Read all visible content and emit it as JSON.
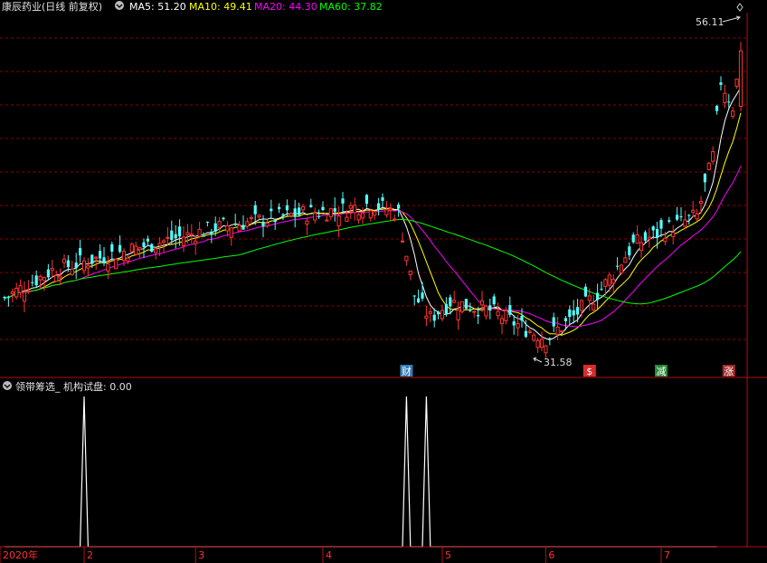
{
  "header": {
    "title": "康辰药业(日线 前复权)",
    "ma5_label": "MA5: 51.20",
    "ma10_label": "MA10: 49.41",
    "ma20_label": "MA20: 44.30",
    "ma60_label": "MA60: 37.82"
  },
  "sub_header": {
    "title": "领带筹选_ 机构试盘: 0.00"
  },
  "colors": {
    "up": "#ff3232",
    "down": "#54ffff",
    "ma5": "#ffffff",
    "ma10": "#ffff00",
    "ma20": "#ff00ff",
    "ma60": "#00ff00",
    "grid": "#8b0000",
    "axis": "#b01010"
  },
  "chart_data": [
    {
      "type": "candlestick",
      "name": "main",
      "ylim": [
        30,
        58
      ],
      "annotations": {
        "high_label": "56.11",
        "low_label": "31.58"
      },
      "event_markers": [
        {
          "index": 101,
          "text": "财",
          "color": "#3b8fd6"
        },
        {
          "index": 147,
          "text": "$",
          "color": "#ff3232"
        },
        {
          "index": 165,
          "text": "减",
          "color": "#2ea043"
        },
        {
          "index": 182,
          "text": "涨",
          "color": "#c03030"
        }
      ]
    },
    {
      "type": "line",
      "name": "indicator",
      "ylim": [
        0,
        1
      ],
      "series": [
        {
          "values": [
            0,
            0,
            0,
            0,
            0,
            0,
            0,
            0,
            0,
            0,
            0,
            0,
            0,
            0,
            0,
            0,
            0,
            0,
            0,
            0,
            1,
            0,
            0,
            0,
            0,
            0,
            0,
            0,
            0,
            0,
            0,
            0,
            0,
            0,
            0,
            0,
            0,
            0,
            0,
            0,
            0,
            0,
            0,
            0,
            0,
            0,
            0,
            0,
            0,
            0,
            0,
            0,
            0,
            0,
            0,
            0,
            0,
            0,
            0,
            0,
            0,
            0,
            0,
            0,
            0,
            0,
            0,
            0,
            0,
            0,
            0,
            0,
            0,
            0,
            0,
            0,
            0,
            0,
            0,
            0,
            0,
            0,
            0,
            0,
            0,
            0,
            0,
            0,
            0,
            0,
            0,
            0,
            0,
            0,
            0,
            0,
            0,
            0,
            0,
            0,
            0,
            1,
            0,
            0,
            0,
            0,
            1,
            0,
            0,
            0,
            0,
            0,
            0,
            0,
            0,
            0,
            0,
            0,
            0,
            0,
            0,
            0,
            0,
            0,
            0,
            0,
            0,
            0,
            0,
            0,
            0,
            0,
            0,
            0,
            0,
            0,
            0,
            0,
            0,
            0,
            0,
            0,
            0,
            0,
            0,
            0,
            0,
            0,
            0,
            0,
            0,
            0,
            0,
            0,
            0,
            0,
            0,
            0,
            0,
            0,
            0,
            0,
            0,
            0,
            0,
            0,
            0,
            0,
            0,
            0,
            0,
            0,
            0,
            0,
            0,
            0,
            0,
            0,
            0,
            0
          ]
        }
      ],
      "x_ticks": [
        {
          "index": 0,
          "label": "2020年"
        },
        {
          "index": 20,
          "label": "2"
        },
        {
          "index": 48,
          "label": "3"
        },
        {
          "index": 80,
          "label": "4"
        },
        {
          "index": 110,
          "label": "5"
        },
        {
          "index": 136,
          "label": "6"
        },
        {
          "index": 165,
          "label": "7"
        }
      ]
    }
  ]
}
